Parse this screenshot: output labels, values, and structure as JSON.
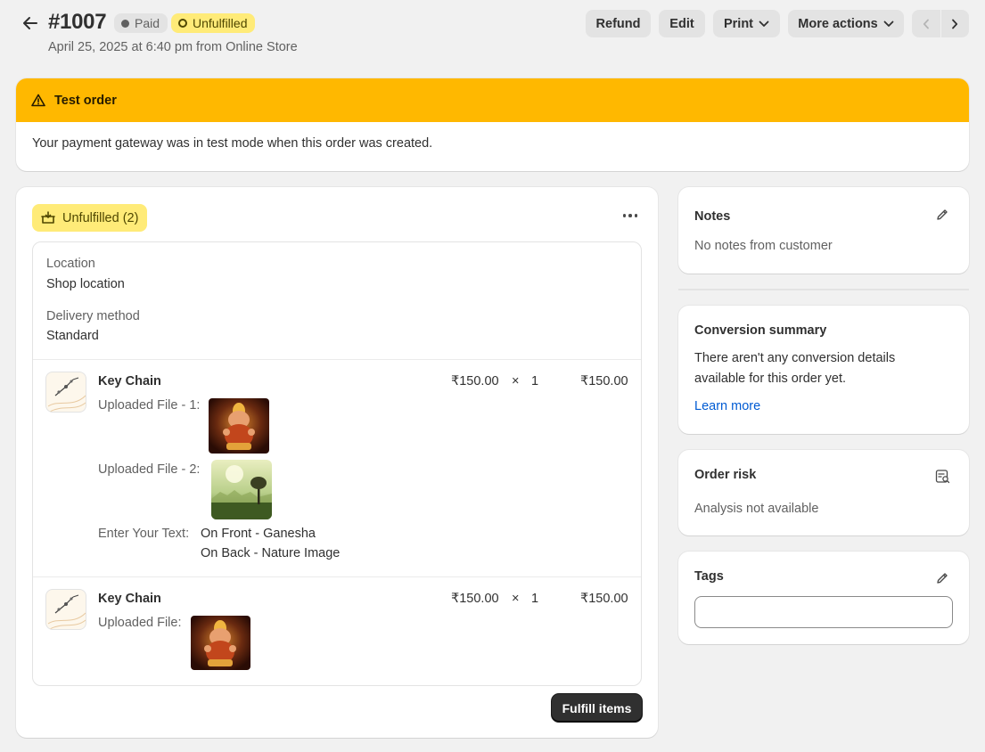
{
  "header": {
    "order_number": "#1007",
    "payment_badge": "Paid",
    "fulfillment_badge": "Unfulfilled",
    "subtitle": "April 25, 2025 at 6:40 pm from Online Store",
    "actions": {
      "refund": "Refund",
      "edit": "Edit",
      "print": "Print",
      "more": "More actions"
    }
  },
  "banner": {
    "title": "Test order",
    "message": "Your payment gateway was in test mode when this order was created.",
    "color": "#ffb800"
  },
  "fulfillment": {
    "status_chip": "Unfulfilled (2)",
    "location_label": "Location",
    "location_value": "Shop location",
    "delivery_label": "Delivery method",
    "delivery_value": "Standard",
    "line_items": [
      {
        "name": "Key Chain",
        "unit_price": "₹150.00",
        "times": "×",
        "quantity": "1",
        "total": "₹150.00",
        "properties": [
          {
            "label": "Uploaded File - 1:"
          },
          {
            "label": "Uploaded File - 2:"
          },
          {
            "label": "Enter Your Text:",
            "value_line1": "On Front - Ganesha",
            "value_line2": "On Back - Nature Image"
          }
        ]
      },
      {
        "name": "Key Chain",
        "unit_price": "₹150.00",
        "times": "×",
        "quantity": "1",
        "total": "₹150.00",
        "properties": [
          {
            "label": "Uploaded File:"
          }
        ]
      }
    ],
    "fulfill_button": "Fulfill items"
  },
  "notes": {
    "title": "Notes",
    "text": "No notes from customer"
  },
  "conversion": {
    "title": "Conversion summary",
    "text_line1": "There aren't any conversion details",
    "text_line2": "available for this order yet.",
    "link": "Learn more"
  },
  "risk": {
    "title": "Order risk",
    "text": "Analysis not available"
  },
  "tags": {
    "title": "Tags",
    "placeholder": ""
  },
  "colors": {
    "accent_link": "#005bd3",
    "unfulfilled_badge": "#ffeb78",
    "primary_button": "#303030"
  }
}
